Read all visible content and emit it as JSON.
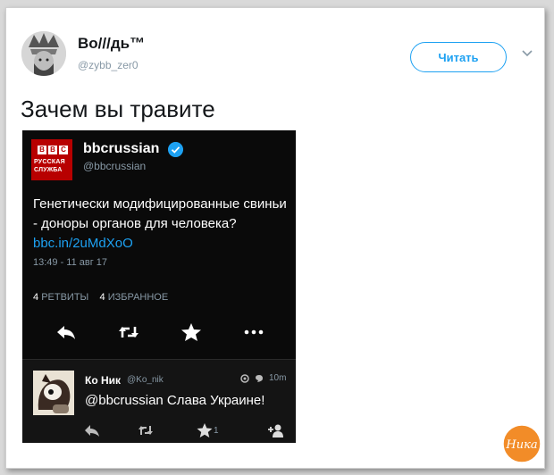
{
  "tweet": {
    "user_name": "Во///дь™",
    "user_handle": "@zybb_zer0",
    "follow_label": "Читать",
    "text": "Зачем вы травите"
  },
  "embedded_tweet": {
    "logo_lines": [
      "РУССКАЯ",
      "СЛУЖБА"
    ],
    "logo_blocks": [
      "B",
      "B",
      "C"
    ],
    "user_name": "bbcrussian",
    "user_handle": "@bbcrussian",
    "body_text": "Генетически модифицированные свиньи - доноры органов для человека?",
    "link_text": "bbc.in/2uMdXoO",
    "timestamp": "13:49 - 11 авг 17",
    "retweets_count": "4",
    "retweets_label": "РЕТВИТЫ",
    "likes_count": "4",
    "likes_label": "ИЗБРАННОЕ"
  },
  "reply": {
    "user_name": "Ко Ник",
    "user_handle": "@Ko_nik",
    "time": "10m",
    "text": "@bbcrussian Слава Украине!",
    "like_count": "1"
  },
  "watermark_text": "Ника",
  "colors": {
    "accent": "#1da1f2",
    "bbc_red": "#b80000",
    "embed_bg": "#0a0a0a"
  }
}
